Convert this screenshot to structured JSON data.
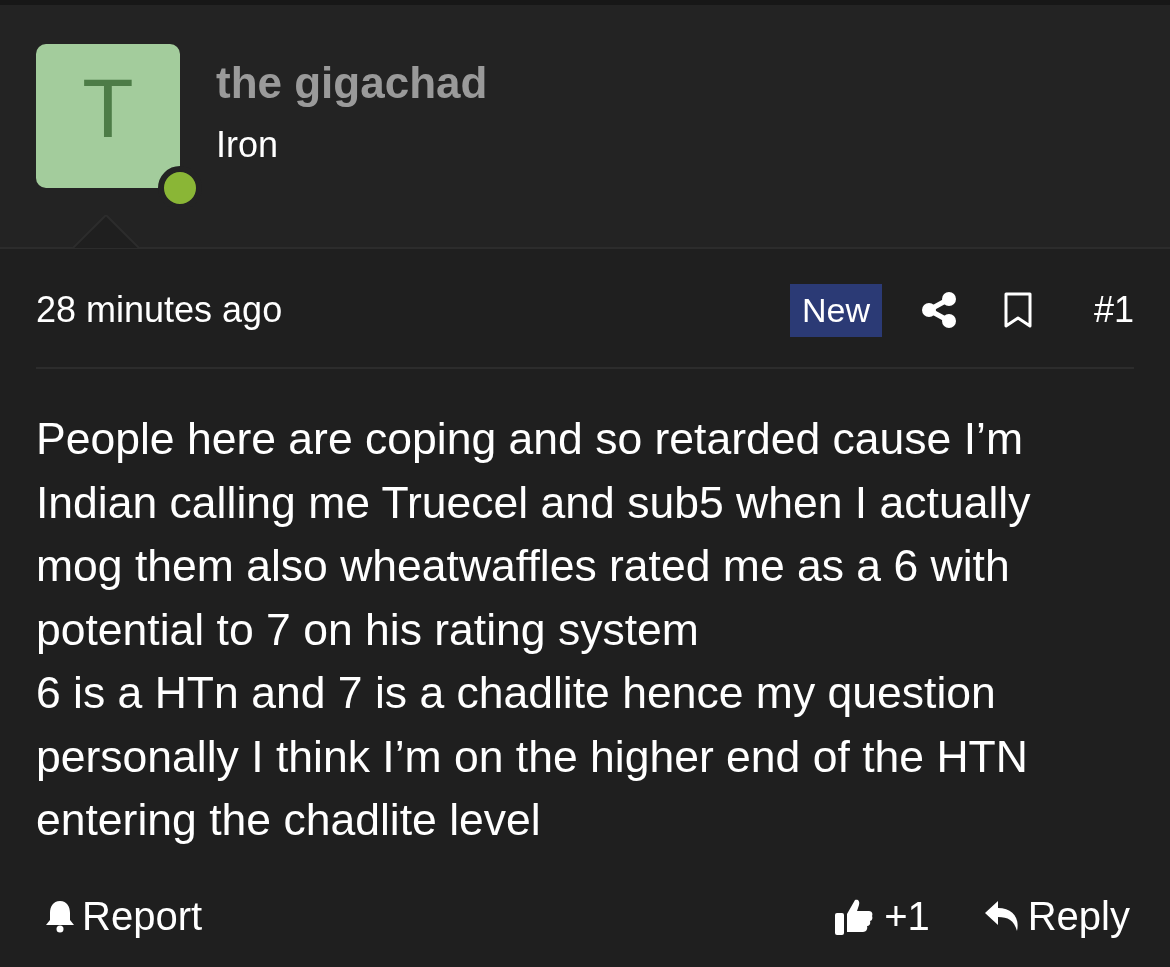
{
  "author": {
    "avatar_letter": "T",
    "name": "the gigachad",
    "rank": "Iron",
    "online": true
  },
  "meta": {
    "time": "28 minutes ago",
    "badge": "New",
    "post_number": "#1"
  },
  "body": [
    "People here are coping and so retarded cause I’m Indian calling me Truecel and sub5 when I actually mog them also wheatwaffles rated me as a 6 with potential to 7 on his rating system",
    "6 is a HTn and 7 is a chadlite hence my question personally I think I’m on the higher end of the HTN entering the chadlite level"
  ],
  "footer": {
    "report": "Report",
    "reaction_count": "+1",
    "reply": "Reply"
  }
}
